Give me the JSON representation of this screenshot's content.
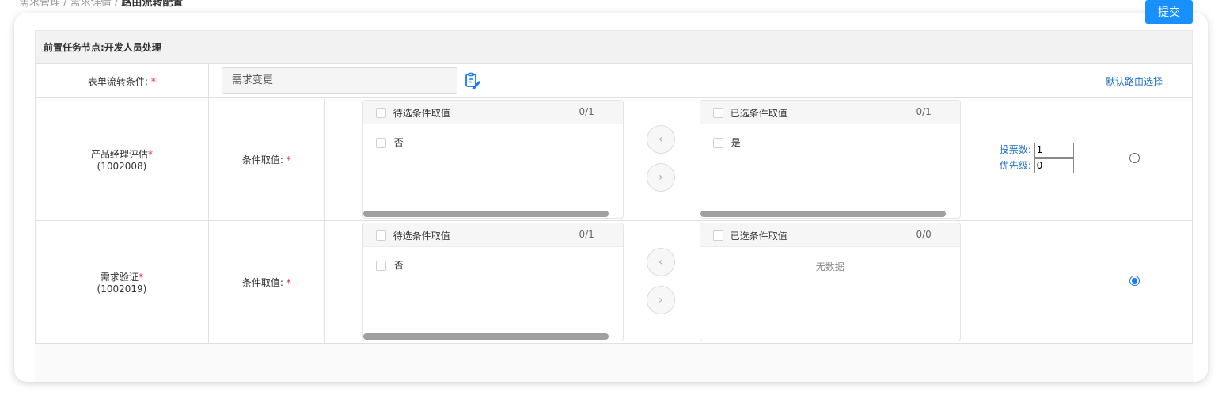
{
  "header": {
    "breadcrumb_prev": "需求管理 / 需求详情 /",
    "breadcrumb_current": "路由流转配置",
    "submit_label": "提交"
  },
  "section": {
    "title": "前置任务节点:开发人员处理"
  },
  "form_row": {
    "label": "表单流转条件:",
    "required_mark": "*",
    "value": "需求变更",
    "edit_icon": "edit-list-icon",
    "default_route_label": "默认路由选择"
  },
  "routes": [
    {
      "name": "产品经理评估",
      "required_mark": "*",
      "code": "(1002008)",
      "condition_label": "条件取值:",
      "condition_required": "*",
      "left_panel": {
        "title": "待选条件取值",
        "count": "0/1",
        "items": [
          "否"
        ]
      },
      "right_panel": {
        "title": "已选条件取值",
        "count": "0/1",
        "items": [
          "是"
        ]
      },
      "vote_label": "投票数:",
      "vote_value": "1",
      "priority_label": "优先级:",
      "priority_value": "0",
      "default_selected": false
    },
    {
      "name": "需求验证",
      "required_mark": "*",
      "code": "(1002019)",
      "condition_label": "条件取值:",
      "condition_required": "*",
      "left_panel": {
        "title": "待选条件取值",
        "count": "0/1",
        "items": [
          "否"
        ]
      },
      "right_panel": {
        "title": "已选条件取值",
        "count": "0/0",
        "items": [],
        "empty_text": "无数据"
      },
      "default_selected": true
    }
  ],
  "transfer": {
    "move_left_icon": "chevron-left-icon",
    "move_right_icon": "chevron-right-icon"
  }
}
